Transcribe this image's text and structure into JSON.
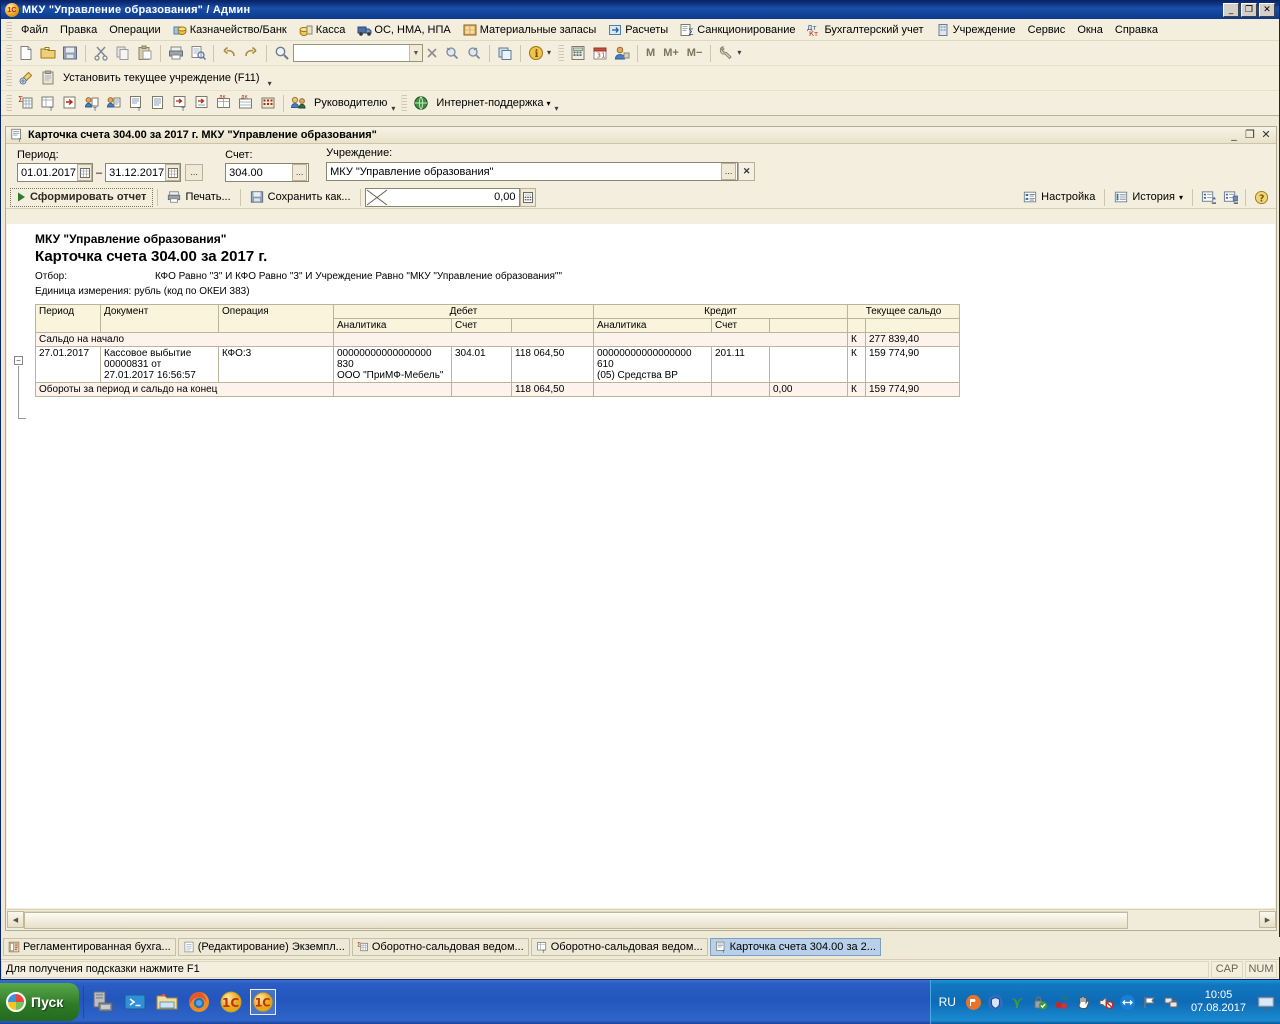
{
  "window": {
    "title": "МКУ \"Управление образования\" / Админ",
    "minimize": "_",
    "maximize": "❐",
    "close": "✕"
  },
  "menubar": [
    {
      "label": "Файл",
      "icon": "none"
    },
    {
      "label": "Правка",
      "icon": "none"
    },
    {
      "label": "Операции",
      "icon": "none"
    },
    {
      "label": "Казначейство/Банк",
      "icon": "bank-icon"
    },
    {
      "label": "Касса",
      "icon": "cash-icon"
    },
    {
      "label": "ОС, НМА, НПА",
      "icon": "truck-icon"
    },
    {
      "label": "Материальные запасы",
      "icon": "warehouse-icon"
    },
    {
      "label": "Расчеты",
      "icon": "calc-icon"
    },
    {
      "label": "Санкционирование",
      "icon": "sigma-icon"
    },
    {
      "label": "Бухгалтерский учет",
      "icon": "dtkt-icon"
    },
    {
      "label": "Учреждение",
      "icon": "building-icon"
    },
    {
      "label": "Сервис",
      "icon": "none"
    },
    {
      "label": "Окна",
      "icon": "none"
    },
    {
      "label": "Справка",
      "icon": "none"
    }
  ],
  "toolbar_main": {
    "icons": [
      "new-document-icon",
      "open-folder-icon",
      "save-icon",
      "cut-icon",
      "copy-icon",
      "paste-icon",
      "print-icon",
      "print-preview-icon",
      "undo-icon",
      "redo-icon",
      "search-icon"
    ],
    "search_value": "",
    "dropdown_icon": "chevron-down-icon",
    "clear_icon": "close-icon",
    "find-next-icon": "find-next-icon",
    "find-prev-icon": "find-prev-icon",
    "right_icons": [
      "windows-icon",
      "info-icon",
      "calculator-icon",
      "calendar-icon",
      "user-icon"
    ],
    "memory_buttons": [
      "M",
      "M+",
      "M−"
    ],
    "tools_icon": "wrench-icon"
  },
  "toolbar_second": {
    "set_institution_label": "Установить текущее учреждение (F11)",
    "icons": [
      "key-icon",
      "clipboard-icon"
    ]
  },
  "toolbar_third": {
    "manager_label": "Руководителю",
    "internet_support_label": "Интернет-поддержка",
    "icons": [
      "report-sigma-icon",
      "report-t-icon",
      "report-in-icon",
      "report-person-t-icon",
      "report-person-icon",
      "report-doc-t-icon",
      "report-doc-icon",
      "report-in-t-icon",
      "report-in-list-icon",
      "report-dk-sigma-icon",
      "report-dk-icon",
      "report-grid-icon"
    ]
  },
  "child_window": {
    "title": "Карточка счета 304.00 за 2017 г. МКУ \"Управление образования\"",
    "icon": "report-t-icon",
    "minimize": "_",
    "restore": "❐",
    "close": "✕"
  },
  "params": {
    "period_label": "Период:",
    "period_from": "01.01.2017",
    "period_dash": "–",
    "period_to": "31.12.2017",
    "period_ellipsis": "...",
    "account_label": "Счет:",
    "account_value": "304.00",
    "account_ellipsis": "...",
    "institution_label": "Учреждение:",
    "institution_value": "МКУ \"Управление образования\"",
    "institution_ellipsis": "...",
    "institution_clear": "✕"
  },
  "report_toolbar": {
    "generate_label": "Сформировать отчет",
    "print_label": "Печать...",
    "save_as_label": "Сохранить как...",
    "amount_value": "0,00",
    "settings_label": "Настройка",
    "history_label": "История",
    "icons": [
      "play-icon",
      "printer-icon",
      "save-icon",
      "calculator-icon",
      "settings-list-icon",
      "history-list-icon",
      "load-settings-icon",
      "save-settings-icon",
      "help-icon"
    ]
  },
  "report": {
    "organization": "МКУ \"Управление образования\"",
    "title": "Карточка счета 304.00 за 2017 г.",
    "filter_label": "Отбор:",
    "filter_value": "КФО Равно \"3\" И КФО Равно \"3\" И Учреждение Равно \"МКУ \"Управление образования\"\"",
    "unit_line": "Единица измерения: рубль (код по ОКЕИ 383)",
    "columns": {
      "period": "Период",
      "document": "Документ",
      "operation": "Операция",
      "debit": "Дебет",
      "credit": "Кредит",
      "current_balance": "Текущее сальдо",
      "analytics": "Аналитика",
      "account": "Счет"
    },
    "opening_label": "Сальдо на начало",
    "opening_balance_side": "К",
    "opening_balance_value": "277 839,40",
    "rows": [
      {
        "period": "27.01.2017",
        "document_line1": "Кассовое выбытие",
        "document_line2": "00000831 от",
        "document_line3": "27.01.2017 16:56:57",
        "operation": "КФО:3",
        "debit_analytics_line1": "00000000000000000",
        "debit_analytics_line2": "830",
        "debit_analytics_line3": "ООО \"ПриМФ-Мебель\"",
        "debit_account": "304.01",
        "debit_amount": "118 064,50",
        "credit_analytics_line1": "00000000000000000",
        "credit_analytics_line2": "610",
        "credit_analytics_line3": "(05) Средства ВР",
        "credit_account": "201.11",
        "credit_amount": "",
        "balance_side": "К",
        "balance_value": "159 774,90"
      }
    ],
    "totals_label": "Обороты за период и сальдо на конец",
    "totals_debit": "118 064,50",
    "totals_credit": "0,00",
    "totals_balance_side": "К",
    "totals_balance_value": "159 774,90",
    "collapse_icon": "−"
  },
  "taskstrip": [
    {
      "label": "Регламентированная бухга...",
      "icon": "book-icon",
      "active": false
    },
    {
      "label": "(Редактирование) Экземпл...",
      "icon": "doc-icon",
      "active": false
    },
    {
      "label": "Оборотно-сальдовая ведом...",
      "icon": "report-sigma-icon",
      "active": false
    },
    {
      "label": "Оборотно-сальдовая ведом...",
      "icon": "report-t-icon",
      "active": false
    },
    {
      "label": "Карточка счета 304.00 за 2...",
      "icon": "report-t-icon",
      "active": true
    }
  ],
  "statusbar": {
    "message": "Для получения подсказки нажмите F1",
    "cap": "CAP",
    "num": "NUM"
  },
  "win_taskbar": {
    "start_label": "Пуск",
    "quick_launch": [
      "server-icon",
      "powershell-icon",
      "explorer-icon",
      "firefox-icon",
      "1c-icon",
      "1c-icon-active"
    ],
    "tray_lang": "RU",
    "tray_icons": [
      "pdf-icon",
      "shield-icon",
      "plant-icon",
      "lock-check-icon",
      "cherry-icon",
      "hand-icon",
      "volume-mute-icon",
      "teamviewer-icon",
      "flag-icon",
      "network-icon"
    ],
    "clock_time": "10:05",
    "clock_date": "07.08.2017",
    "show-desktop-icon": "monitor-icon"
  }
}
